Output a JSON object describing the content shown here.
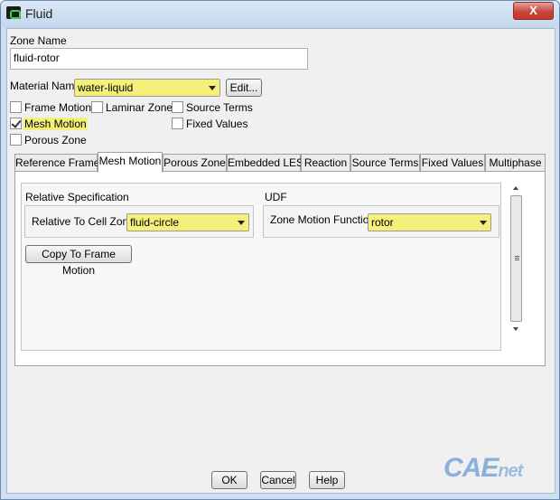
{
  "window": {
    "title": "Fluid",
    "close_glyph": "X"
  },
  "zone_name": {
    "label": "Zone Name",
    "value": "fluid-rotor"
  },
  "material": {
    "label": "Material Name",
    "value": "water-liquid",
    "edit_label": "Edit..."
  },
  "options": {
    "frame_motion": {
      "label": "Frame Motion",
      "checked": false
    },
    "laminar_zone": {
      "label": "Laminar Zone",
      "checked": false
    },
    "source_terms": {
      "label": "Source Terms",
      "checked": false
    },
    "mesh_motion": {
      "label": "Mesh Motion",
      "checked": true
    },
    "fixed_values": {
      "label": "Fixed Values",
      "checked": false
    },
    "porous_zone": {
      "label": "Porous Zone",
      "checked": false
    }
  },
  "tabs": [
    {
      "label": "Reference Frame",
      "active": false
    },
    {
      "label": "Mesh Motion",
      "active": true
    },
    {
      "label": "Porous Zone",
      "active": false
    },
    {
      "label": "Embedded LES",
      "active": false
    },
    {
      "label": "Reaction",
      "active": false
    },
    {
      "label": "Source Terms",
      "active": false
    },
    {
      "label": "Fixed Values",
      "active": false
    },
    {
      "label": "Multiphase",
      "active": false
    }
  ],
  "mesh_motion_panel": {
    "relative_spec": {
      "heading": "Relative Specification",
      "label": "Relative To Cell Zone",
      "value": "fluid-circle"
    },
    "udf": {
      "heading": "UDF",
      "label": "Zone Motion Function",
      "value": "rotor"
    },
    "copy_button": "Copy To Frame Motion"
  },
  "footer": {
    "ok": "OK",
    "cancel": "Cancel",
    "help": "Help"
  },
  "watermark": {
    "main": "CAE",
    "suffix": "net"
  },
  "colors": {
    "highlight": "#f5f07a",
    "titlebar": "#c3d7ee",
    "close": "#c7463b"
  }
}
